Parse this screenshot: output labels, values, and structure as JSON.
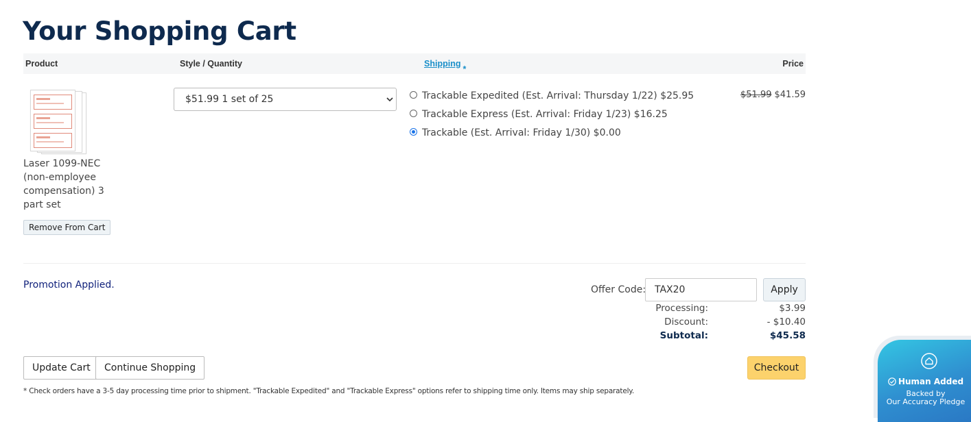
{
  "page": {
    "title": "Your Shopping Cart"
  },
  "table": {
    "headers": {
      "product": "Product",
      "style_quantity": "Style / Quantity",
      "shipping": "Shipping",
      "shipping_marker": "*",
      "price": "Price"
    }
  },
  "item": {
    "name": "Laser 1099-NEC (non-employee compensation) 3 part set",
    "remove_label": "Remove From Cart",
    "quantity_selected": "$51.99 1 set of 25",
    "shipping_options": [
      {
        "label": "Trackable Expedited (Est. Arrival: Thursday 1/22) $25.95",
        "selected": false
      },
      {
        "label": "Trackable Express (Est. Arrival: Friday 1/23) $16.25",
        "selected": false
      },
      {
        "label": "Trackable (Est. Arrival: Friday 1/30) $0.00",
        "selected": true
      }
    ],
    "price_original": "$51.99",
    "price_discounted": "$41.59"
  },
  "promo": {
    "message": "Promotion Applied."
  },
  "offer": {
    "label": "Offer Code:",
    "value": "TAX20",
    "apply_label": "Apply"
  },
  "summary": {
    "processing_label": "Processing:",
    "processing_value": "$3.99",
    "discount_label": "Discount:",
    "discount_value": "- $10.40",
    "subtotal_label": "Subtotal:",
    "subtotal_value": "$45.58"
  },
  "actions": {
    "update_label": "Update Cart",
    "continue_label": "Continue Shopping",
    "checkout_label": "Checkout"
  },
  "footnote": "* Check orders have a 3-5 day processing time prior to shipment. \"Trackable Expedited\" and \"Trackable Express\" options refer to shipping time only. Items may ship separately.",
  "badge": {
    "title": "Human Added",
    "line1": "Backed by",
    "line2": "Our Accuracy Pledge"
  },
  "colors": {
    "title": "#0e2a4e",
    "link": "#1a8fc9",
    "checkout": "#fcd26c",
    "promo": "#0e1f7a",
    "badge_gradient_start": "#34c6e3",
    "badge_gradient_end": "#2a78c4"
  },
  "icons": {
    "product": "form-thumbnail",
    "select": "chevron-down-icon",
    "badge": "home-chat-icon",
    "badge_check": "check-circle-icon"
  }
}
